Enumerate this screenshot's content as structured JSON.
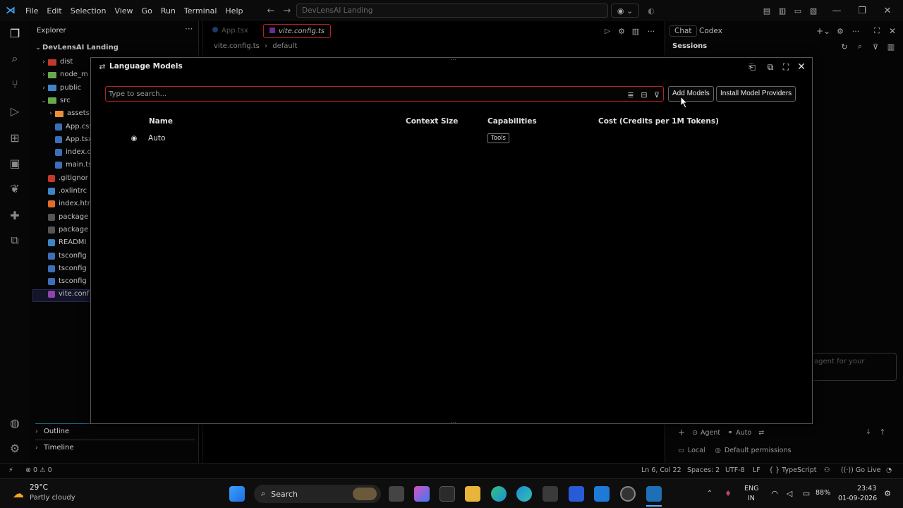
{
  "titlebar": {
    "menus": [
      "File",
      "Edit",
      "Selection",
      "View",
      "Go",
      "Run",
      "Terminal",
      "Help"
    ],
    "command_center": "DevLensAI Landing"
  },
  "sidebar": {
    "title": "Explorer",
    "project": "DevLensAI Landing",
    "tree": [
      {
        "label": "dist",
        "kind": "folder",
        "depth": 1,
        "color": "#c0392b"
      },
      {
        "label": "node_m",
        "kind": "folder",
        "depth": 1,
        "color": "#6aa84f"
      },
      {
        "label": "public",
        "kind": "folder",
        "depth": 1,
        "color": "#3d85c6"
      },
      {
        "label": "src",
        "kind": "folder-open",
        "depth": 1,
        "color": "#6aa84f"
      },
      {
        "label": "assets",
        "kind": "folder",
        "depth": 2,
        "color": "#e69138"
      },
      {
        "label": "App.css",
        "kind": "file",
        "depth": 2,
        "color": "#3d6fb6"
      },
      {
        "label": "App.tsx",
        "kind": "file",
        "depth": 2,
        "color": "#3d6fb6"
      },
      {
        "label": "index.c",
        "kind": "file",
        "depth": 2,
        "color": "#3d6fb6"
      },
      {
        "label": "main.ts",
        "kind": "file",
        "depth": 2,
        "color": "#3d6fb6"
      },
      {
        "label": ".gitignor",
        "kind": "file",
        "depth": 1,
        "color": "#c0392b"
      },
      {
        "label": ".oxlintrc",
        "kind": "file",
        "depth": 1,
        "color": "#3d85c6"
      },
      {
        "label": "index.htm",
        "kind": "file",
        "depth": 1,
        "color": "#e06c2c"
      },
      {
        "label": "package",
        "kind": "file",
        "depth": 1,
        "color": "#555555"
      },
      {
        "label": "package",
        "kind": "file",
        "depth": 1,
        "color": "#555555"
      },
      {
        "label": "READMI",
        "kind": "file",
        "depth": 1,
        "color": "#3d85c6"
      },
      {
        "label": "tsconfig",
        "kind": "file",
        "depth": 1,
        "color": "#3d6fb6"
      },
      {
        "label": "tsconfig",
        "kind": "file",
        "depth": 1,
        "color": "#3d6fb6"
      },
      {
        "label": "tsconfig",
        "kind": "file",
        "depth": 1,
        "color": "#3d6fb6"
      },
      {
        "label": "vite.conf",
        "kind": "file",
        "depth": 1,
        "color": "#8e44ad"
      }
    ],
    "outline": "Outline",
    "timeline": "Timeline"
  },
  "editor": {
    "tabs": [
      {
        "label": "App.tsx",
        "active": false
      },
      {
        "label": "vite.config.ts",
        "active": true
      }
    ],
    "breadcrumb": [
      "vite.config.ts",
      "default"
    ]
  },
  "chat": {
    "tabs": [
      "Chat",
      "Codex"
    ],
    "sessions_label": "Sessions",
    "input_placeholder": "agent for your",
    "mode_agent": "Agent",
    "mode_model": "Auto",
    "location": "Local",
    "permissions": "Default permissions"
  },
  "dialog": {
    "title": "Language Models",
    "search_placeholder": "Type to search...",
    "buttons": {
      "add_models": "Add Models",
      "install_providers": "Install Model Providers"
    },
    "columns": {
      "name": "Name",
      "context_size": "Context Size",
      "capabilities": "Capabilities",
      "cost": "Cost (Credits per 1M Tokens)"
    },
    "rows": [
      {
        "name": "Auto",
        "context_size": "",
        "capabilities": "Tools",
        "cost": ""
      }
    ]
  },
  "statusbar": {
    "errors": "0",
    "warnings": "0",
    "position": "Ln 6, Col 22",
    "spaces": "Spaces: 2",
    "encoding": "UTF-8",
    "eol": "LF",
    "language": "TypeScript",
    "golive": "Go Live"
  },
  "taskbar": {
    "temperature": "29°C",
    "weather": "Partly cloudy",
    "search": "Search",
    "lang": "ENG",
    "region": "IN",
    "battery": "88%",
    "time": "23:43",
    "date": "01-09-2026"
  },
  "colors": {
    "search_border": "#b32424",
    "accent": "#3fa7ff"
  }
}
